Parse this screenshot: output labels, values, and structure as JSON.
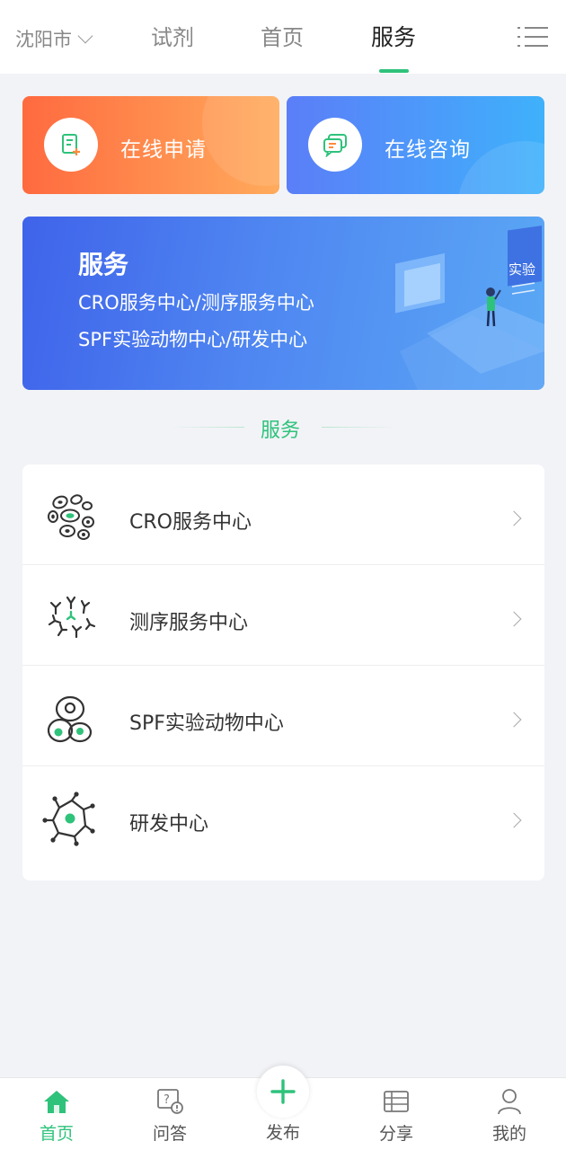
{
  "header": {
    "city": "沈阳市",
    "tabs": [
      {
        "label": "试剂",
        "active": false
      },
      {
        "label": "首页",
        "active": false
      },
      {
        "label": "服务",
        "active": true
      }
    ],
    "menu_icon": "list-menu-icon"
  },
  "quick_actions": [
    {
      "label": "在线申请",
      "icon": "apply-form-icon",
      "gradient": [
        "#ff6a3f",
        "#ffab5c"
      ]
    },
    {
      "label": "在线咨询",
      "icon": "chat-icon",
      "gradient": [
        "#5b7ef8",
        "#3fb1fb"
      ]
    }
  ],
  "banner": {
    "title": "服务",
    "line1": "CRO服务中心/测序服务中心",
    "line2": "SPF实验动物中心/研发中心",
    "sign_text": "实验"
  },
  "section": {
    "title": "服务"
  },
  "services": [
    {
      "label": "CRO服务中心",
      "icon": "cells-icon"
    },
    {
      "label": "测序服务中心",
      "icon": "antibody-icon"
    },
    {
      "label": "SPF实验动物中心",
      "icon": "cell-culture-icon"
    },
    {
      "label": "研发中心",
      "icon": "network-node-icon"
    }
  ],
  "bottom_nav": [
    {
      "label": "首页",
      "icon": "home-icon",
      "active": true
    },
    {
      "label": "问答",
      "icon": "qa-icon",
      "active": false
    },
    {
      "label": "发布",
      "icon": "plus-icon",
      "active": false
    },
    {
      "label": "分享",
      "icon": "share-icon",
      "active": false
    },
    {
      "label": "我的",
      "icon": "profile-icon",
      "active": false
    }
  ],
  "colors": {
    "accent": "#2fc27b",
    "background": "#f2f3f7"
  }
}
